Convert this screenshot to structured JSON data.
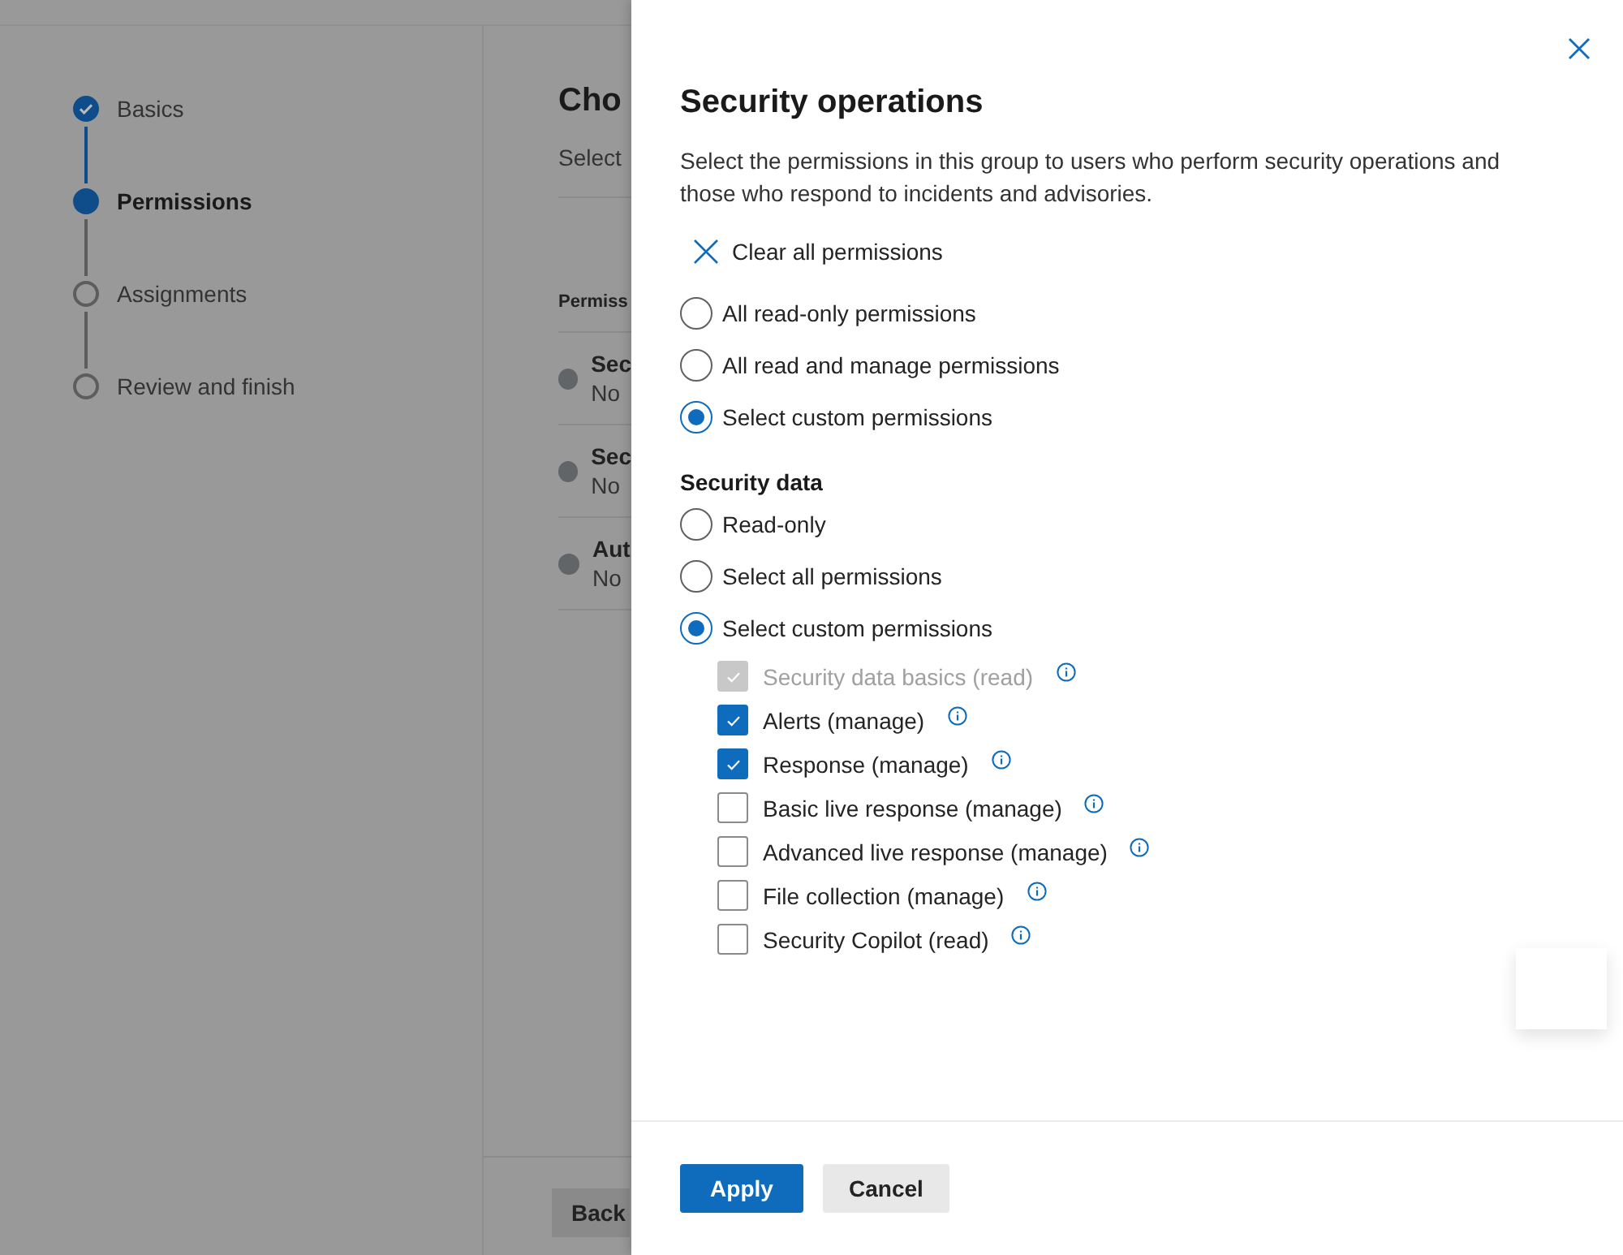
{
  "wizard": {
    "steps": [
      {
        "label": "Basics",
        "done": true,
        "selected": false
      },
      {
        "label": "Permissions",
        "done": false,
        "selected": true
      },
      {
        "label": "Assignments",
        "done": false,
        "selected": false
      },
      {
        "label": "Review and finish",
        "done": false,
        "selected": false
      }
    ]
  },
  "main": {
    "title": "Cho",
    "subtitle": "Select",
    "column_header": "Permiss",
    "rows": [
      {
        "name": "Sec",
        "value": "No"
      },
      {
        "name": "Sec",
        "value": "No"
      },
      {
        "name": "Aut",
        "value": "No"
      }
    ],
    "back_button": "Back"
  },
  "panel": {
    "title": "Security operations",
    "description": "Select the permissions in this group to users who perform security operations and those who respond to incidents and advisories.",
    "clear_all": "Clear all permissions",
    "group_options": [
      {
        "label": "All read-only permissions",
        "selected": false
      },
      {
        "label": "All read and manage permissions",
        "selected": false
      },
      {
        "label": "Select custom permissions",
        "selected": true
      }
    ],
    "section_title": "Security data",
    "section_options": [
      {
        "label": "Read-only",
        "selected": false
      },
      {
        "label": "Select all permissions",
        "selected": false
      },
      {
        "label": "Select custom permissions",
        "selected": true
      }
    ],
    "permissions": [
      {
        "label": "Security data basics (read)",
        "checked": true,
        "disabled": true
      },
      {
        "label": "Alerts (manage)",
        "checked": true,
        "disabled": false
      },
      {
        "label": "Response (manage)",
        "checked": true,
        "disabled": false
      },
      {
        "label": "Basic live response (manage)",
        "checked": false,
        "disabled": false
      },
      {
        "label": "Advanced live response (manage)",
        "checked": false,
        "disabled": false
      },
      {
        "label": "File collection (manage)",
        "checked": false,
        "disabled": false
      },
      {
        "label": "Security Copilot (read)",
        "checked": false,
        "disabled": false
      }
    ],
    "buttons": {
      "primary": "Apply",
      "secondary": "Cancel"
    }
  }
}
